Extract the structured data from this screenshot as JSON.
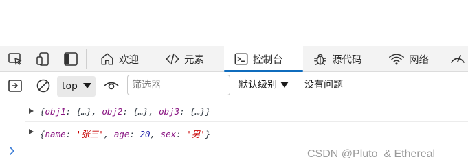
{
  "tabs": [
    {
      "label": "欢迎",
      "icon": "home-icon"
    },
    {
      "label": "元素",
      "icon": "code-icon"
    },
    {
      "label": "控制台",
      "icon": "console-icon",
      "active": true
    },
    {
      "label": "源代码",
      "icon": "bug-icon"
    },
    {
      "label": "网络",
      "icon": "wifi-icon"
    }
  ],
  "toolbar": {
    "context": "top",
    "filter_placeholder": "筛选器",
    "levels": "默认级别",
    "issues": "没有问题"
  },
  "console": {
    "line1": {
      "t1": "{",
      "k1": "obj1",
      "t2": ": {…}, ",
      "k2": "obj2",
      "t3": ": {…}, ",
      "k3": "obj3",
      "t4": ": {…}}"
    },
    "line2": {
      "t1": "{",
      "k1": "name",
      "t2": ": ",
      "v1": "'张三'",
      "t3": ", ",
      "k2": "age",
      "t4": ": ",
      "v2": "20",
      "t5": ", ",
      "k3": "sex",
      "t6": ": ",
      "v3": "'男'",
      "t7": "}"
    }
  },
  "watermark": "CSDN @Pluto  & Ethereal",
  "colors": {
    "accent": "#0f6cbd",
    "key": "#881280",
    "string": "#c80000",
    "number": "#1a1aa6"
  }
}
